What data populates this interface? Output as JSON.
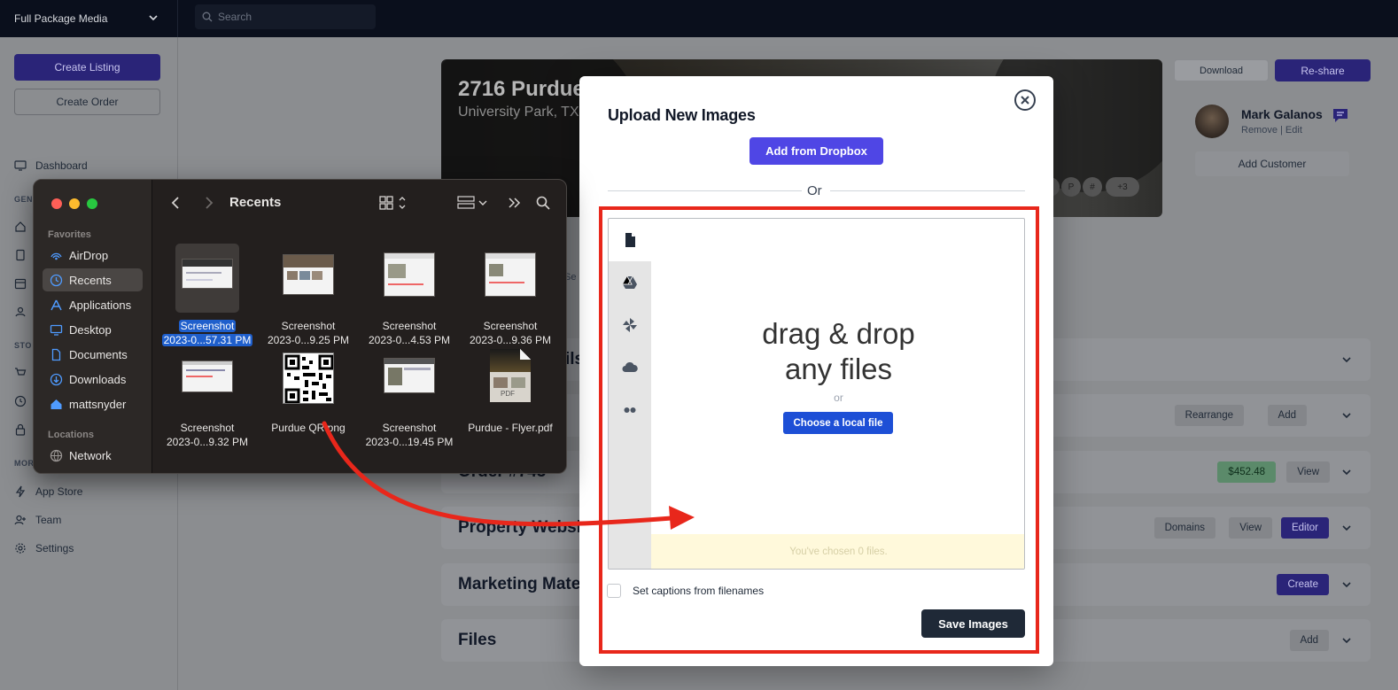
{
  "topbar": {
    "org_name": "Full Package Media",
    "search_placeholder": "Search"
  },
  "sidebar": {
    "create_listing": "Create Listing",
    "create_order": "Create Order",
    "dashboard": "Dashboard",
    "section_general_frag": "GEN",
    "section_store_frag": "STO",
    "section_more_frag": "MOR",
    "app_store": "App Store",
    "team": "Team",
    "settings": "Settings"
  },
  "listing": {
    "title_frag": "2716 Purdue",
    "subtitle_frag": "University Park, TX",
    "more_social": "+3",
    "tab_frag": "Se"
  },
  "actions": {
    "download": "Download",
    "reshare": "Re-share"
  },
  "customer": {
    "name": "Mark Galanos",
    "actions": "Remove | Edit",
    "add_customer": "Add Customer"
  },
  "sections": {
    "details_frag": "ils",
    "rearrange": "Rearrange",
    "add": "Add",
    "order_frag": "Order #743",
    "order_total": "$452.48",
    "view": "View",
    "property_website_frag": "Property Websi",
    "domains": "Domains",
    "editor": "Editor",
    "marketing_frag": "Marketing Mate",
    "create": "Create",
    "files": "Files"
  },
  "finder": {
    "title": "Recents",
    "favorites_heading": "Favorites",
    "favorites": [
      "AirDrop",
      "Recents",
      "Applications",
      "Desktop",
      "Documents",
      "Downloads",
      "mattsnyder"
    ],
    "locations_heading": "Locations",
    "locations": [
      "Network"
    ],
    "files": [
      {
        "line1": "Screenshot",
        "line2": "2023-0...57.31 PM"
      },
      {
        "line1": "Screenshot",
        "line2": "2023-0...9.25 PM"
      },
      {
        "line1": "Screenshot",
        "line2": "2023-0...4.53 PM"
      },
      {
        "line1": "Screenshot",
        "line2": "2023-0...9.36 PM"
      },
      {
        "line1": "Screenshot",
        "line2": "2023-0...9.32 PM"
      },
      {
        "line1": "Purdue QR.png",
        "line2": ""
      },
      {
        "line1": "Screenshot",
        "line2": "2023-0...19.45 PM"
      },
      {
        "line1": "Purdue - Flyer.pdf",
        "line2": ""
      }
    ],
    "pdf_badge": "PDF"
  },
  "modal": {
    "title": "Upload New Images",
    "dropbox_button": "Add from Dropbox",
    "or": "Or",
    "drop_line1": "drag & drop",
    "drop_line2": "any files",
    "drop_or": "or",
    "choose_local": "Choose a local file",
    "chosen_status": "You've chosen 0 files.",
    "captions_label": "Set captions from filenames",
    "save_button": "Save Images"
  },
  "colors": {
    "accent": "#4f46e5",
    "highlight": "#e8271b",
    "local_button": "#1d4fd6"
  }
}
